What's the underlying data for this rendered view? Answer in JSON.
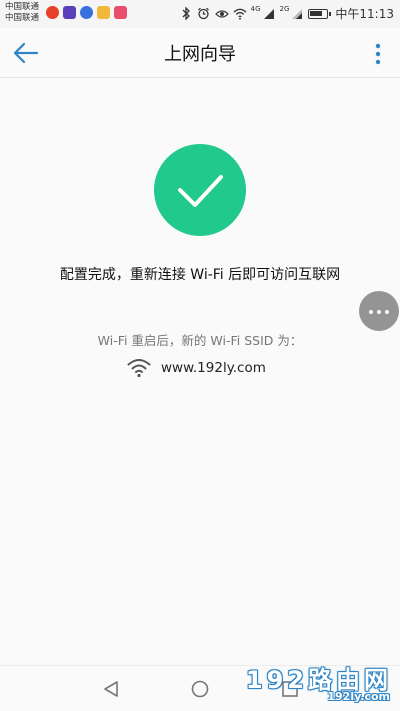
{
  "status_bar": {
    "carrier_1": "中国联通",
    "carrier_2": "中国联通",
    "network_1": "4G",
    "network_2": "2G",
    "time": "中午11:13"
  },
  "header": {
    "title": "上网向导"
  },
  "main": {
    "message": "配置完成，重新连接 Wi-Fi 后即可访问互联网",
    "ssid_label": "Wi-Fi 重启后，新的 Wi-Fi SSID 为：",
    "ssid_value": "www.192ly.com"
  },
  "watermark": {
    "main": "192路由网",
    "sub": "192ly.com"
  },
  "colors": {
    "accent": "#2f84c5",
    "success": "#21c98c"
  }
}
